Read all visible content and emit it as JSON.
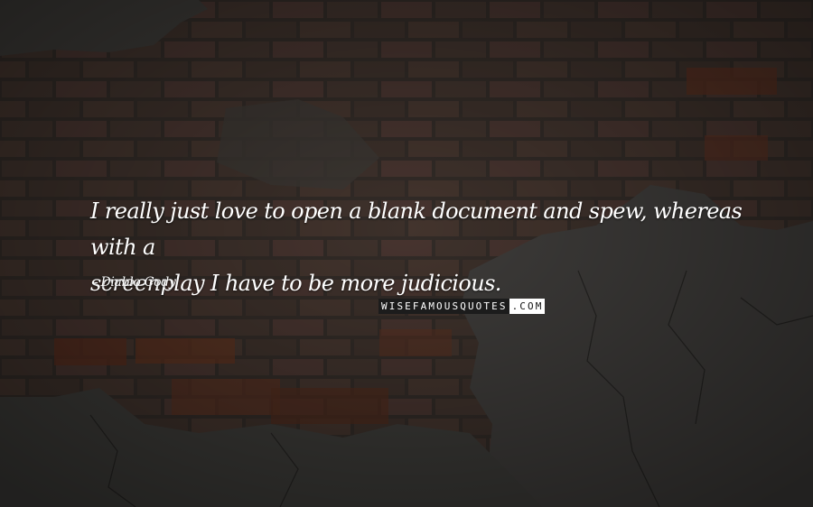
{
  "quote": {
    "line1": "I really just love to open a blank document and spew, whereas with a",
    "line2": "screenplay I have to be more judicious."
  },
  "author": {
    "dash": "-",
    "name": "Diablo Cody"
  },
  "watermark": {
    "dark_part": "WISEFAMOUSQUOTES",
    "light_part": ".COM"
  },
  "colors": {
    "text": "#ffffff",
    "wall_dark": "#3a3632",
    "brick": "#5a3a2e"
  }
}
